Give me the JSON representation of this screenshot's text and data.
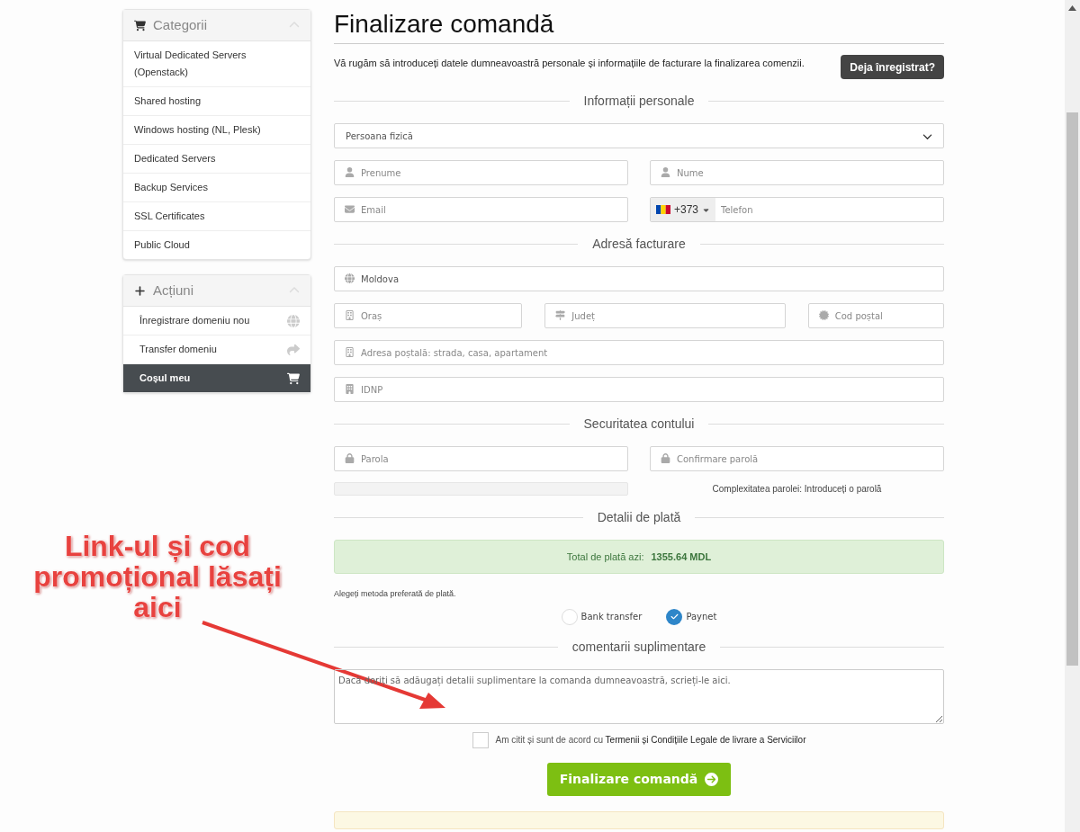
{
  "sidebar": {
    "panels": [
      {
        "title": "Categorii",
        "kind": "cart",
        "items": [
          {
            "label": "Virtual Dedicated Servers (Openstack)"
          },
          {
            "label": "Shared hosting"
          },
          {
            "label": "Windows hosting (NL, Plesk)"
          },
          {
            "label": "Dedicated Servers"
          },
          {
            "label": "Backup Services"
          },
          {
            "label": "SSL Certificates"
          },
          {
            "label": "Public Cloud"
          }
        ]
      },
      {
        "title": "Acțiuni",
        "kind": "plus",
        "items": [
          {
            "label": "Înregistrare domeniu nou",
            "kind": "globe",
            "selected": false
          },
          {
            "label": "Transfer domeniu",
            "kind": "share",
            "selected": false
          },
          {
            "label": "Coșul meu",
            "kind": "cart",
            "selected": true
          }
        ]
      }
    ]
  },
  "page": {
    "title": "Finalizare comandă",
    "intro": "Vă rugăm să introduceți datele dumneavoastră personale și informațiile de facturare la finalizarea comenzii.",
    "login_button": "Deja înregistrat?"
  },
  "sections": [
    {
      "title": "Informații personale",
      "rows": [
        [
          {
            "kind": "select",
            "value": "Persoana fizică"
          }
        ],
        [
          {
            "kind": "person",
            "placeholder": "Prenume"
          },
          {
            "kind": "person",
            "placeholder": "Nume"
          }
        ],
        [
          {
            "kind": "email",
            "placeholder": "Email"
          },
          {
            "kind": "phone",
            "prefix": "+373",
            "placeholder": "Telefon"
          }
        ]
      ]
    },
    {
      "title": "Adresă facturare",
      "rows": [
        [
          {
            "kind": "globe",
            "value": "Moldova"
          }
        ],
        [
          {
            "kind": "building",
            "placeholder": "Oraș"
          },
          {
            "kind": "signpost",
            "placeholder": "Județ"
          },
          {
            "kind": "cog",
            "placeholder": "Cod poștal"
          }
        ],
        [
          {
            "kind": "building",
            "placeholder": "Adresa poștală: strada, casa, apartament"
          }
        ],
        [
          {
            "kind": "office",
            "placeholder": "IDNP"
          }
        ]
      ]
    },
    {
      "title": "Securitatea contului",
      "rows": [
        [
          {
            "kind": "lock",
            "placeholder": "Parola"
          },
          {
            "kind": "lock",
            "placeholder": "Confirmare parolă"
          }
        ]
      ],
      "strength": {
        "level": 0,
        "text": "Complexitatea parolei: Introduceți o parolă"
      }
    }
  ],
  "payment": {
    "title": "Detalii de plată",
    "total_label": "Total de plată azi:",
    "total_value": "1355.64 MDL",
    "hint": "Alegeți metoda preferată de plată.",
    "methods": [
      {
        "label": "Bank transfer",
        "selected": false
      },
      {
        "label": "Paynet",
        "selected": true
      }
    ]
  },
  "comments": {
    "title": "comentarii suplimentare",
    "placeholder": "Dacă doriți să adăugați detalii suplimentare la comanda dumneavoastră, scrieți-le aici."
  },
  "terms": {
    "checked": false,
    "text": "Am citit și sunt de acord cu ",
    "link": "Termenii și Condițiile Legale de livrare a Serviciilor"
  },
  "submit_button": "Finalizare comandă",
  "annotation": {
    "lines": [
      "Link-ul și cod",
      "promoțional lăsați",
      "aici"
    ]
  }
}
